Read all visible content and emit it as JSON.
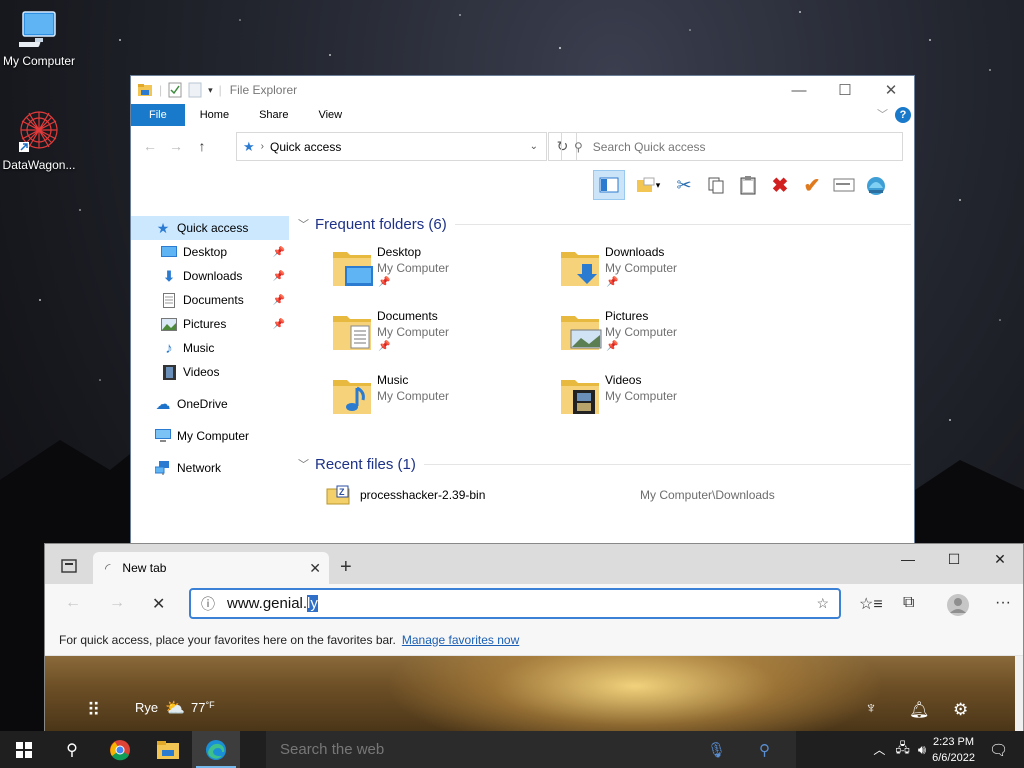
{
  "desktop": {
    "icons": [
      {
        "label": "My Computer",
        "icon": "monitor-icon"
      },
      {
        "label": "DataWagon...",
        "icon": "datawagon-app-icon"
      }
    ]
  },
  "explorer": {
    "title": "File Explorer",
    "ribbon_tabs": [
      "File",
      "Home",
      "Share",
      "View"
    ],
    "address_crumb": "Quick access",
    "search_placeholder": "Search Quick access",
    "sidebar": [
      {
        "label": "Quick access",
        "icon": "star-icon",
        "active": true
      },
      {
        "label": "Desktop",
        "icon": "desktop-folder-icon",
        "pinned": true
      },
      {
        "label": "Downloads",
        "icon": "download-arrow-icon",
        "pinned": true
      },
      {
        "label": "Documents",
        "icon": "document-icon",
        "pinned": true
      },
      {
        "label": "Pictures",
        "icon": "pictures-icon",
        "pinned": true
      },
      {
        "label": "Music",
        "icon": "music-note-icon"
      },
      {
        "label": "Videos",
        "icon": "film-icon"
      },
      {
        "label": "OneDrive",
        "icon": "cloud-icon"
      },
      {
        "label": "My Computer",
        "icon": "monitor-icon"
      },
      {
        "label": "Network",
        "icon": "network-icon"
      }
    ],
    "frequent_title": "Frequent folders (6)",
    "folders": [
      {
        "name": "Desktop",
        "location": "My Computer",
        "pinned": true
      },
      {
        "name": "Downloads",
        "location": "My Computer",
        "pinned": true
      },
      {
        "name": "Documents",
        "location": "My Computer",
        "pinned": true
      },
      {
        "name": "Pictures",
        "location": "My Computer",
        "pinned": true
      },
      {
        "name": "Music",
        "location": "My Computer",
        "pinned": false
      },
      {
        "name": "Videos",
        "location": "My Computer",
        "pinned": false
      }
    ],
    "recent_title": "Recent files (1)",
    "recent_files": [
      {
        "name": "processhacker-2.39-bin",
        "path": "My Computer\\Downloads"
      }
    ]
  },
  "edge": {
    "tab_label": "New tab",
    "url_typed": "www.genial.",
    "url_selected": "ly",
    "favbar_text": "For quick access, place your favorites here on the favorites bar.",
    "favbar_link": "Manage favorites now",
    "location": "Rye",
    "temperature": "77",
    "temp_unit": "°F"
  },
  "taskbar": {
    "search_placeholder": "Search the web",
    "time": "2:23 PM",
    "date": "6/6/2022"
  }
}
